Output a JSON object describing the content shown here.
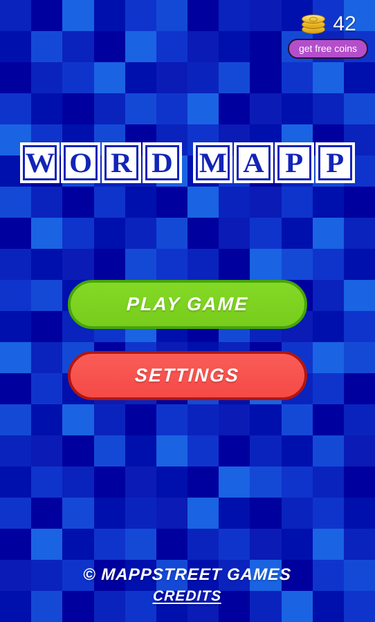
{
  "app": {
    "title": "Word Mapp",
    "background_color": "#0019b4"
  },
  "hud": {
    "coin_icon": "coin-stack-icon",
    "coin_count": "42",
    "free_coins_label": "get free coins",
    "free_coins_color": "#b44ecb"
  },
  "logo": {
    "words": [
      {
        "letters": [
          "W",
          "O",
          "R",
          "D"
        ]
      },
      {
        "letters": [
          "M",
          "A",
          "P",
          "P"
        ]
      }
    ],
    "tile_face_color": "#ffffff",
    "tile_letter_color": "#1324b8"
  },
  "menu": {
    "play_label": "PLAY GAME",
    "play_color": "#7ed321",
    "play_border_color": "#46a508",
    "settings_label": "SETTINGS",
    "settings_color": "#f9534f",
    "settings_border_color": "#b21510"
  },
  "footer": {
    "copyright": "© MAPPSTREET GAMES",
    "credits_label": "CREDITS"
  },
  "mosaic": {
    "cols": 12,
    "rows": 20,
    "palette": [
      "#00009e",
      "#0010ad",
      "#0a23bd",
      "#0f34cc",
      "#1449d6",
      "#1a63e2",
      "#0b1bb5",
      "#0514a6"
    ],
    "cells": [
      2,
      0,
      5,
      1,
      3,
      4,
      0,
      2,
      6,
      1,
      3,
      5,
      1,
      4,
      2,
      0,
      5,
      3,
      6,
      1,
      0,
      4,
      2,
      3,
      0,
      2,
      3,
      5,
      1,
      6,
      2,
      4,
      0,
      3,
      5,
      1,
      3,
      1,
      0,
      2,
      4,
      3,
      5,
      0,
      6,
      1,
      2,
      4,
      5,
      3,
      1,
      4,
      0,
      2,
      3,
      6,
      1,
      5,
      0,
      2,
      1,
      0,
      4,
      2,
      6,
      5,
      1,
      3,
      0,
      2,
      4,
      3,
      4,
      2,
      0,
      3,
      1,
      0,
      5,
      2,
      6,
      3,
      1,
      0,
      0,
      5,
      3,
      1,
      2,
      4,
      0,
      6,
      3,
      1,
      5,
      2,
      2,
      1,
      6,
      0,
      4,
      3,
      2,
      0,
      5,
      4,
      3,
      1,
      3,
      4,
      1,
      5,
      0,
      2,
      6,
      3,
      1,
      0,
      2,
      5,
      1,
      0,
      2,
      3,
      5,
      1,
      0,
      4,
      2,
      6,
      1,
      3,
      5,
      2,
      4,
      0,
      3,
      6,
      1,
      2,
      0,
      3,
      5,
      4,
      0,
      3,
      1,
      6,
      2,
      0,
      4,
      1,
      5,
      2,
      3,
      0,
      4,
      1,
      5,
      2,
      0,
      3,
      2,
      6,
      1,
      4,
      0,
      2,
      2,
      6,
      0,
      4,
      1,
      5,
      3,
      0,
      2,
      1,
      4,
      6,
      1,
      3,
      2,
      0,
      6,
      1,
      0,
      5,
      4,
      3,
      2,
      0,
      3,
      0,
      4,
      1,
      2,
      6,
      5,
      1,
      0,
      2,
      3,
      1,
      0,
      5,
      1,
      3,
      4,
      0,
      2,
      3,
      6,
      1,
      5,
      2,
      6,
      2,
      3,
      0,
      1,
      4,
      1,
      2,
      5,
      0,
      3,
      4,
      1,
      4,
      0,
      2,
      3,
      1,
      6,
      0,
      2,
      5,
      1,
      3
    ]
  }
}
